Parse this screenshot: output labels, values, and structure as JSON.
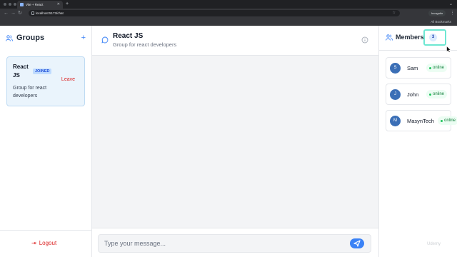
{
  "browser": {
    "tab_title": "Vite + React",
    "url": "localhost:5173/chat",
    "incognito_label": "Incognito",
    "bookmarks_label": "All Bookmarks"
  },
  "sidebar": {
    "title": "Groups",
    "add_label": "+",
    "groups": [
      {
        "name": "React JS",
        "badge": "JOINED",
        "action": "Leave",
        "description": "Group for react developers"
      }
    ],
    "logout_label": "Logout"
  },
  "chat": {
    "title": "React JS",
    "subtitle": "Group for react developers",
    "input_placeholder": "Type your message..."
  },
  "members": {
    "title": "Members",
    "count": "3",
    "list": [
      {
        "initial": "S",
        "name": "Sam",
        "status": "online"
      },
      {
        "initial": "J",
        "name": "John",
        "status": "online"
      },
      {
        "initial": "M",
        "name": "MasynTech",
        "status": "online"
      }
    ]
  },
  "colors": {
    "accent": "#3b82f6",
    "danger": "#dc2626",
    "online": "#22c55e",
    "highlight": "#6ee7d2"
  },
  "icons": {
    "groups": "users-icon",
    "add": "plus-icon",
    "chat": "message-circle-icon",
    "info": "info-icon",
    "send": "send-icon",
    "logout": "logout-icon",
    "members": "users-icon"
  },
  "watermark": "Udemy"
}
